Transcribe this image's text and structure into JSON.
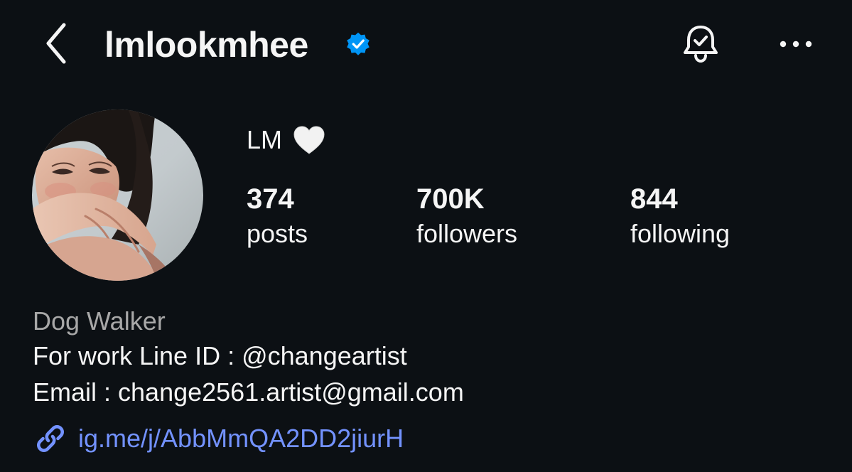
{
  "header": {
    "username": "lmlookmhee",
    "back_icon": "chevron-left-icon",
    "verified_icon": "verified-badge-icon",
    "bell_icon": "notification-bell-icon",
    "more_icon": "more-horizontal-icon"
  },
  "profile": {
    "display_name": "LM",
    "display_name_emoji": "white-heart-icon",
    "stats": {
      "posts": {
        "value": "374",
        "label": "posts"
      },
      "followers": {
        "value": "700K",
        "label": "followers"
      },
      "following": {
        "value": "844",
        "label": "following"
      }
    }
  },
  "bio": {
    "category": "Dog Walker",
    "line1": "For work Line ID : @changeartist",
    "line2": "Email : change2561.artist@gmail.com",
    "link": "ig.me/j/AbbMmQA2DD2jiurH",
    "link_icon": "link-icon"
  },
  "colors": {
    "background": "#0c1014",
    "text": "#f5f5f5",
    "secondary_text": "#a8a8a8",
    "link": "#7392ff",
    "verified": "#0095f6"
  }
}
